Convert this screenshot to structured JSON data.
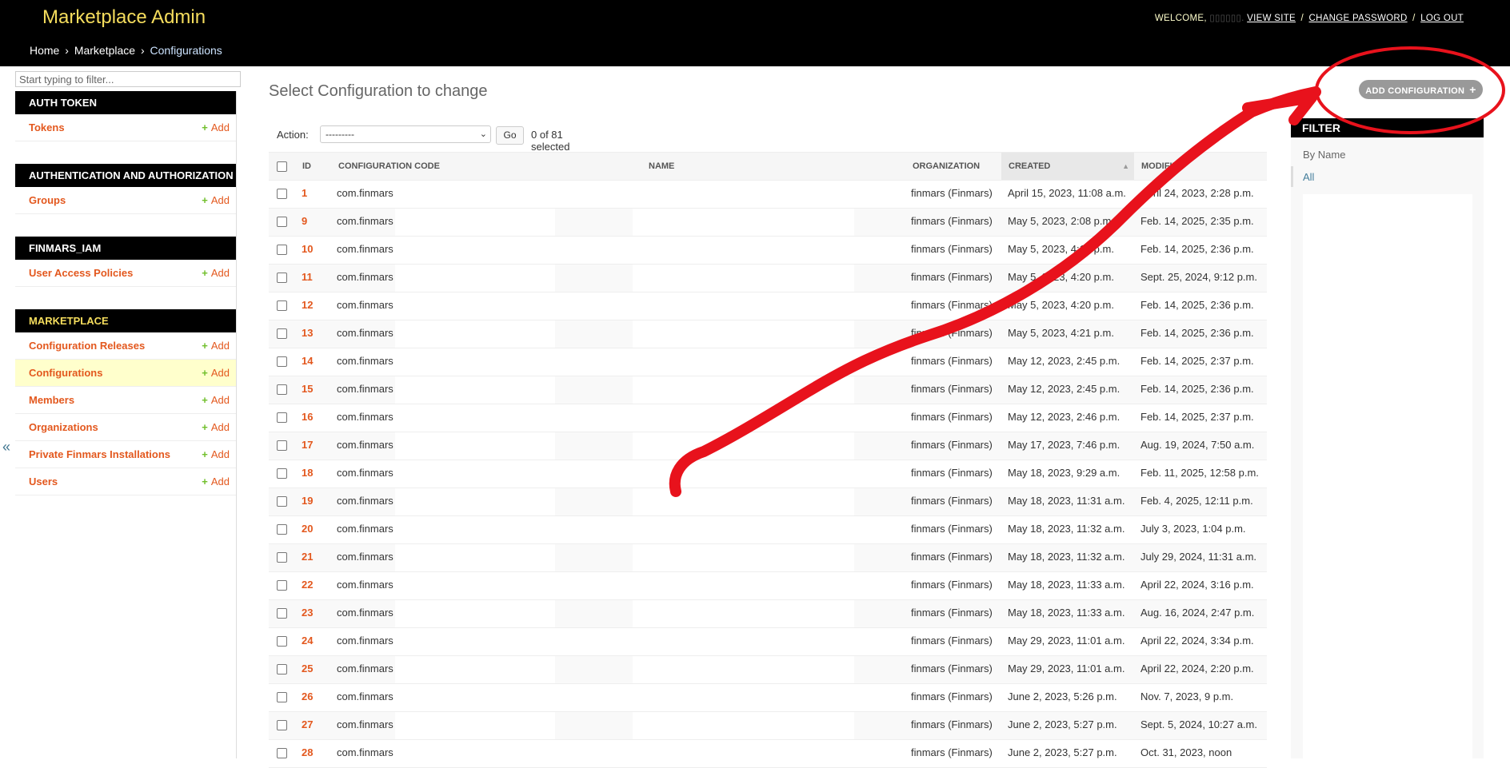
{
  "header": {
    "site_title": "Marketplace Admin",
    "welcome": "WELCOME,",
    "masked_user": "▯▯▯▯▯▯.",
    "view_site": "VIEW SITE",
    "change_password": "CHANGE PASSWORD",
    "log_out": "LOG OUT",
    "separator": "/"
  },
  "breadcrumbs": {
    "home": "Home",
    "app": "Marketplace",
    "current": "Configurations",
    "separator": "›"
  },
  "sidebar": {
    "filter_placeholder": "Start typing to filter...",
    "collapse_icon": "«",
    "add_label": "Add",
    "apps": [
      {
        "name": "AUTH TOKEN",
        "models": [
          "Tokens"
        ]
      },
      {
        "name": "AUTHENTICATION AND AUTHORIZATION",
        "models": [
          "Groups"
        ]
      },
      {
        "name": "FINMARS_IAM",
        "models": [
          "User Access Policies"
        ]
      },
      {
        "name": "MARKETPLACE",
        "models": [
          "Configuration Releases",
          "Configurations",
          "Members",
          "Organizations",
          "Private Finmars Installations",
          "Users"
        ]
      }
    ]
  },
  "main": {
    "title": "Select Configuration to change",
    "action_label": "Action:",
    "action_selected": "---------",
    "go_label": "Go",
    "selected_count": "0 of 81 selected",
    "columns": {
      "id": "ID",
      "code": "CONFIGURATION CODE",
      "name": "NAME",
      "organization": "ORGANIZATION",
      "created": "CREATED",
      "modified": "MODIFIED"
    },
    "rows": [
      {
        "id": "1",
        "code": "com.finmars",
        "org": "finmars (Finmars)",
        "created": "April 15, 2023, 11:08 a.m.",
        "modified": "April 24, 2023, 2:28 p.m."
      },
      {
        "id": "9",
        "code": "com.finmars",
        "org": "finmars (Finmars)",
        "created": "May 5, 2023, 2:08 p.m.",
        "modified": "Feb. 14, 2025, 2:35 p.m."
      },
      {
        "id": "10",
        "code": "com.finmars",
        "org": "finmars (Finmars)",
        "created": "May 5, 2023, 4:19 p.m.",
        "modified": "Feb. 14, 2025, 2:36 p.m."
      },
      {
        "id": "11",
        "code": "com.finmars",
        "org": "finmars (Finmars)",
        "created": "May 5, 2023, 4:20 p.m.",
        "modified": "Sept. 25, 2024, 9:12 p.m."
      },
      {
        "id": "12",
        "code": "com.finmars",
        "org": "finmars (Finmars)",
        "created": "May 5, 2023, 4:20 p.m.",
        "modified": "Feb. 14, 2025, 2:36 p.m."
      },
      {
        "id": "13",
        "code": "com.finmars",
        "org": "finmars (Finmars)",
        "created": "May 5, 2023, 4:21 p.m.",
        "modified": "Feb. 14, 2025, 2:36 p.m."
      },
      {
        "id": "14",
        "code": "com.finmars",
        "org": "finmars (Finmars)",
        "created": "May 12, 2023, 2:45 p.m.",
        "modified": "Feb. 14, 2025, 2:37 p.m."
      },
      {
        "id": "15",
        "code": "com.finmars",
        "org": "finmars (Finmars)",
        "created": "May 12, 2023, 2:45 p.m.",
        "modified": "Feb. 14, 2025, 2:36 p.m."
      },
      {
        "id": "16",
        "code": "com.finmars",
        "org": "finmars (Finmars)",
        "created": "May 12, 2023, 2:46 p.m.",
        "modified": "Feb. 14, 2025, 2:37 p.m."
      },
      {
        "id": "17",
        "code": "com.finmars",
        "org": "finmars (Finmars)",
        "created": "May 17, 2023, 7:46 p.m.",
        "modified": "Aug. 19, 2024, 7:50 a.m."
      },
      {
        "id": "18",
        "code": "com.finmars",
        "org": "finmars (Finmars)",
        "created": "May 18, 2023, 9:29 a.m.",
        "modified": "Feb. 11, 2025, 12:58 p.m."
      },
      {
        "id": "19",
        "code": "com.finmars",
        "org": "finmars (Finmars)",
        "created": "May 18, 2023, 11:31 a.m.",
        "modified": "Feb. 4, 2025, 12:11 p.m."
      },
      {
        "id": "20",
        "code": "com.finmars",
        "org": "finmars (Finmars)",
        "created": "May 18, 2023, 11:32 a.m.",
        "modified": "July 3, 2023, 1:04 p.m."
      },
      {
        "id": "21",
        "code": "com.finmars",
        "org": "finmars (Finmars)",
        "created": "May 18, 2023, 11:32 a.m.",
        "modified": "July 29, 2024, 11:31 a.m."
      },
      {
        "id": "22",
        "code": "com.finmars",
        "org": "finmars (Finmars)",
        "created": "May 18, 2023, 11:33 a.m.",
        "modified": "April 22, 2024, 3:16 p.m."
      },
      {
        "id": "23",
        "code": "com.finmars",
        "org": "finmars (Finmars)",
        "created": "May 18, 2023, 11:33 a.m.",
        "modified": "Aug. 16, 2024, 2:47 p.m."
      },
      {
        "id": "24",
        "code": "com.finmars",
        "org": "finmars (Finmars)",
        "created": "May 29, 2023, 11:01 a.m.",
        "modified": "April 22, 2024, 3:34 p.m."
      },
      {
        "id": "25",
        "code": "com.finmars",
        "org": "finmars (Finmars)",
        "created": "May 29, 2023, 11:01 a.m.",
        "modified": "April 22, 2024, 2:20 p.m."
      },
      {
        "id": "26",
        "code": "com.finmars",
        "org": "finmars (Finmars)",
        "created": "June 2, 2023, 5:26 p.m.",
        "modified": "Nov. 7, 2023, 9 p.m."
      },
      {
        "id": "27",
        "code": "com.finmars",
        "org": "finmars (Finmars)",
        "created": "June 2, 2023, 5:27 p.m.",
        "modified": "Sept. 5, 2024, 10:27 a.m."
      },
      {
        "id": "28",
        "code": "com.finmars",
        "org": "finmars (Finmars)",
        "created": "June 2, 2023, 5:27 p.m.",
        "modified": "Oct. 31, 2023, noon"
      }
    ]
  },
  "right_panel": {
    "add_button": "ADD CONFIGURATION",
    "add_icon": "+",
    "filter_title": "FILTER",
    "filter_by": "By Name",
    "filter_all": "All"
  },
  "colors": {
    "header_bg": "#000000",
    "title_yellow": "#f5dd5d",
    "link_orange": "#e3581e",
    "add_green": "#70bf2b",
    "current_row": "#ffffcc",
    "annotation_red": "#e8121c"
  }
}
